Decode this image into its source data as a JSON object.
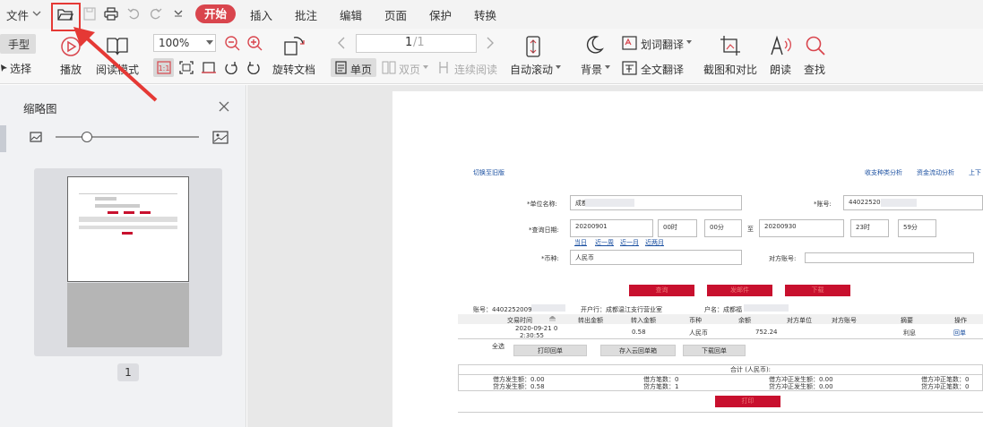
{
  "menu": {
    "file": "文件",
    "tabs": [
      "开始",
      "插入",
      "批注",
      "编辑",
      "页面",
      "保护",
      "转换"
    ]
  },
  "toolbar": {
    "hand": "手型",
    "select": "选择",
    "play": "播放",
    "read_mode": "阅读模式",
    "zoom": "100%",
    "fit_icon_label": "1:1",
    "rotate": "旋转文档",
    "page_indicator": "1/1",
    "page_current": "1",
    "page_total": "/1",
    "single": "单页",
    "double": "双页",
    "continuous": "连续阅读",
    "auto_scroll": "自动滚动",
    "background": "背景",
    "word_translate": "划词翻译",
    "full_translate": "全文翻译",
    "screenshot": "截图和对比",
    "read_aloud": "朗读",
    "find": "查找"
  },
  "sidebar": {
    "title": "缩略图",
    "slider_level": 0.22,
    "page_number": "1"
  },
  "document": {
    "switch_old": "切换至旧版",
    "link_income": "收支种类分析",
    "link_flow": "资金流动分析",
    "link_more": "上下",
    "unit_label": "*单位名称:",
    "unit_value": "成都",
    "account_label": "*账号:",
    "account_value": "44022520",
    "date_label": "*查询日期:",
    "date_from": "20200901",
    "hour_from": "00时",
    "min_from": "00分",
    "to": "至",
    "date_to": "20200930",
    "hour_to": "23时",
    "min_to": "59分",
    "quick_links": [
      "当日",
      "近一周",
      "近一月",
      "近两月"
    ],
    "currency_label": "*币种:",
    "currency_value": "人民币",
    "opp_account_label": "对方账号:",
    "btn_query": "查询",
    "btn_send": "发邮件",
    "btn_download": "下载",
    "info_account": "账号：44022520091",
    "info_bank": "开户行：成都温江支行营业室",
    "info_name": "户名：成都福",
    "columns": [
      "交易时间",
      "转出金额",
      "转入金额",
      "币种",
      "余额",
      "对方单位",
      "对方账号",
      "摘要",
      "操作"
    ],
    "row": {
      "time": "2020-09-21 0",
      "time2": "2:30:55",
      "out": "",
      "in": "0.58",
      "currency": "人民币",
      "balance": "752.24",
      "opp_unit": "",
      "opp_account": "",
      "summary": "利息",
      "action": "回单"
    },
    "select_all": "全选",
    "btn_print": "打印回单",
    "btn_save_cloud": "存入云回单箱",
    "btn_download_receipt": "下载回单",
    "total_label": "合计 (人民币):",
    "debit_amount": "借方发生额：0.00",
    "debit_count": "借方笔数：0",
    "debit_reverse_amount": "借方冲正发生额：0.00",
    "debit_reverse_count": "借方冲正笔数：0",
    "credit_amount": "贷方发生额：0.58",
    "credit_count": "贷方笔数：1",
    "credit_reverse_amount": "贷方冲正发生额：0.00",
    "credit_reverse_count": "贷方冲正笔数：0",
    "btn_print2": "打印"
  },
  "colors": {
    "accent": "#d9454d",
    "highlight": "#e53935",
    "doc_red": "#c8102e",
    "link_blue": "#1a4fa0"
  }
}
